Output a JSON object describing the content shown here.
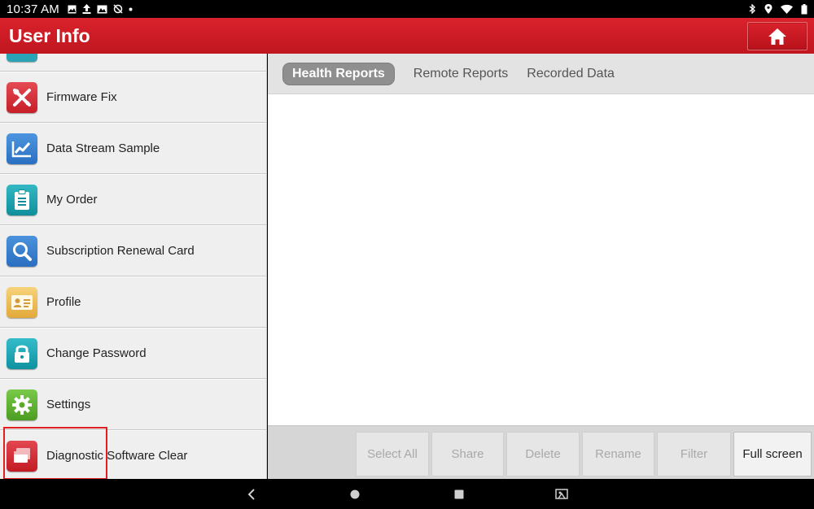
{
  "status_bar": {
    "time": "10:37 AM"
  },
  "header": {
    "title": "User Info",
    "home_icon": "home-icon"
  },
  "sidebar": {
    "items": [
      {
        "label": "",
        "icon": "partial-icon",
        "color": "#2aa3b6"
      },
      {
        "label": "Firmware Fix",
        "icon": "tools-icon",
        "color": "#d8323c"
      },
      {
        "label": "Data Stream Sample",
        "icon": "chart-icon",
        "color": "#2f7fd1"
      },
      {
        "label": "My Order",
        "icon": "clipboard-icon",
        "color": "#14a3b0"
      },
      {
        "label": "Subscription Renewal Card",
        "icon": "magnifier-icon",
        "color": "#2e7fcf"
      },
      {
        "label": "Profile",
        "icon": "id-card-icon",
        "color": "#e8b84a"
      },
      {
        "label": "Change Password",
        "icon": "lock-icon",
        "color": "#16a3b3"
      },
      {
        "label": "Settings",
        "icon": "gear-icon",
        "color": "#5fb42d"
      },
      {
        "label": "Diagnostic Software Clear",
        "icon": "clear-icon",
        "color": "#d42a33"
      }
    ]
  },
  "tabs": [
    {
      "label": "Health Reports",
      "active": true
    },
    {
      "label": "Remote Reports",
      "active": false
    },
    {
      "label": "Recorded Data",
      "active": false
    }
  ],
  "actions": {
    "select_all": "Select All",
    "share": "Share",
    "delete": "Delete",
    "rename": "Rename",
    "filter": "Filter",
    "full_screen": "Full screen"
  },
  "nav": {
    "back_icon": "back-icon",
    "home_icon": "home-circle-icon",
    "recents_icon": "recents-icon",
    "screenshot_icon": "screen-capture-icon"
  },
  "colors": {
    "header_red": "#d21f28",
    "highlight": "#e02020",
    "active_tab": "#8f8f8f"
  }
}
